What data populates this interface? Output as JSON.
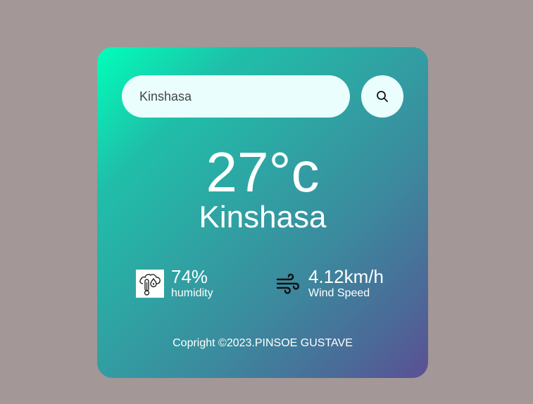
{
  "search": {
    "value": "Kinshasa",
    "placeholder": "",
    "button_icon": "search-icon"
  },
  "weather": {
    "temperature": "27°c",
    "city": "Kinshasa"
  },
  "humidity": {
    "icon": "humidity-icon",
    "value": "74%",
    "label": "humidity"
  },
  "wind": {
    "icon": "wind-icon",
    "value": "4.12km/h",
    "label": "Wind Speed"
  },
  "footer": {
    "text": "Copright ©2023.PINSOE GUSTAVE"
  },
  "colors": {
    "background": "#a39797",
    "gradient_start": "#00ffb9",
    "gradient_end": "#5b4f94",
    "input_bg": "#eafffd"
  }
}
